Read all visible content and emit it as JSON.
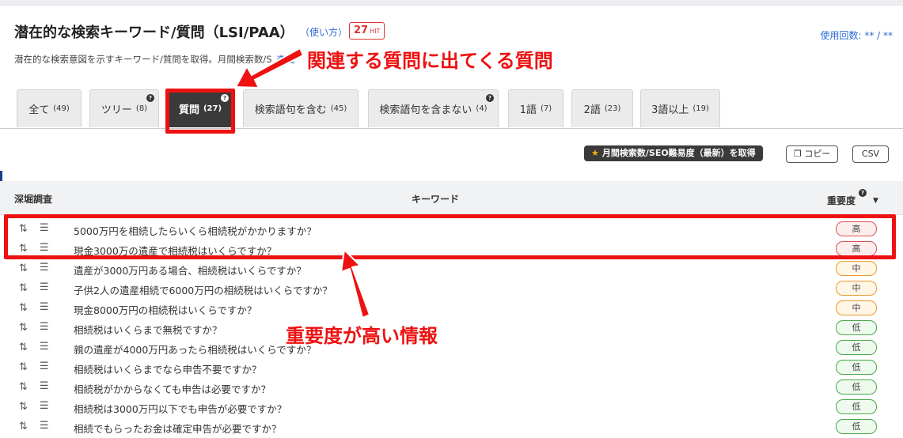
{
  "header": {
    "title": "潜在的な検索キーワード/質問（LSI/PAA）",
    "howto": "（使い方）",
    "hit_count": "27",
    "hit_unit": "HIT",
    "usage": "使用回数: ** / **",
    "desc_left": "潜在的な検索意図を示すキーワード/質問を取得。月間検索数/S",
    "desc_mid": "査機"
  },
  "tabs": [
    {
      "label": "全て",
      "count": "(49)"
    },
    {
      "label": "ツリー",
      "count": "(8)"
    },
    {
      "label": "質問",
      "count": "(27)"
    },
    {
      "label": "検索語句を含む",
      "count": "(45)"
    },
    {
      "label": "検索語句を含まない",
      "count": "(4)"
    },
    {
      "label": "1語",
      "count": "(7)"
    },
    {
      "label": "2語",
      "count": "(23)"
    },
    {
      "label": "3語以上",
      "count": "(19)"
    }
  ],
  "help_glyph": "?",
  "actions": {
    "fetch_label": "月間検索数/SEO難易度（最新）を取得",
    "copy_label": "コピー",
    "csv_label": "CSV"
  },
  "table": {
    "col_deep": "深堀調査",
    "col_keyword": "キーワード",
    "col_importance": "重要度",
    "rows": [
      {
        "keyword": "5000万円を相続したらいくら相続税がかかりますか？",
        "importance": "高",
        "level": "high"
      },
      {
        "keyword": "現金3000万の遺産で相続税はいくらですか？",
        "importance": "高",
        "level": "high"
      },
      {
        "keyword": "遺産が3000万円ある場合、相続税はいくらですか？",
        "importance": "中",
        "level": "mid"
      },
      {
        "keyword": "子供2人の遺産相続で6000万円の相続税はいくらですか？",
        "importance": "中",
        "level": "mid"
      },
      {
        "keyword": "現金8000万円の相続税はいくらですか？",
        "importance": "中",
        "level": "mid"
      },
      {
        "keyword": "相続税はいくらまで無税ですか？",
        "importance": "低",
        "level": "low"
      },
      {
        "keyword": "親の遺産が4000万円あったら相続税はいくらですか？",
        "importance": "低",
        "level": "low"
      },
      {
        "keyword": "相続税はいくらまでなら申告不要ですか？",
        "importance": "低",
        "level": "low"
      },
      {
        "keyword": "相続税がかからなくても申告は必要ですか？",
        "importance": "低",
        "level": "low"
      },
      {
        "keyword": "相続税は3000万円以下でも申告が必要ですか？",
        "importance": "低",
        "level": "low"
      },
      {
        "keyword": "相続でもらったお金は確定申告が必要ですか？",
        "importance": "低",
        "level": "low"
      }
    ]
  },
  "annotations": {
    "top": "関連する質問に出てくる質問",
    "bottom": "重要度が高い情報",
    "color": "#ee1111"
  },
  "colors": {
    "active_tab": "#3a3a3a",
    "link": "#2b6bd6",
    "high": "#d9534f",
    "mid": "#e89b2b",
    "low": "#4aa84a"
  }
}
